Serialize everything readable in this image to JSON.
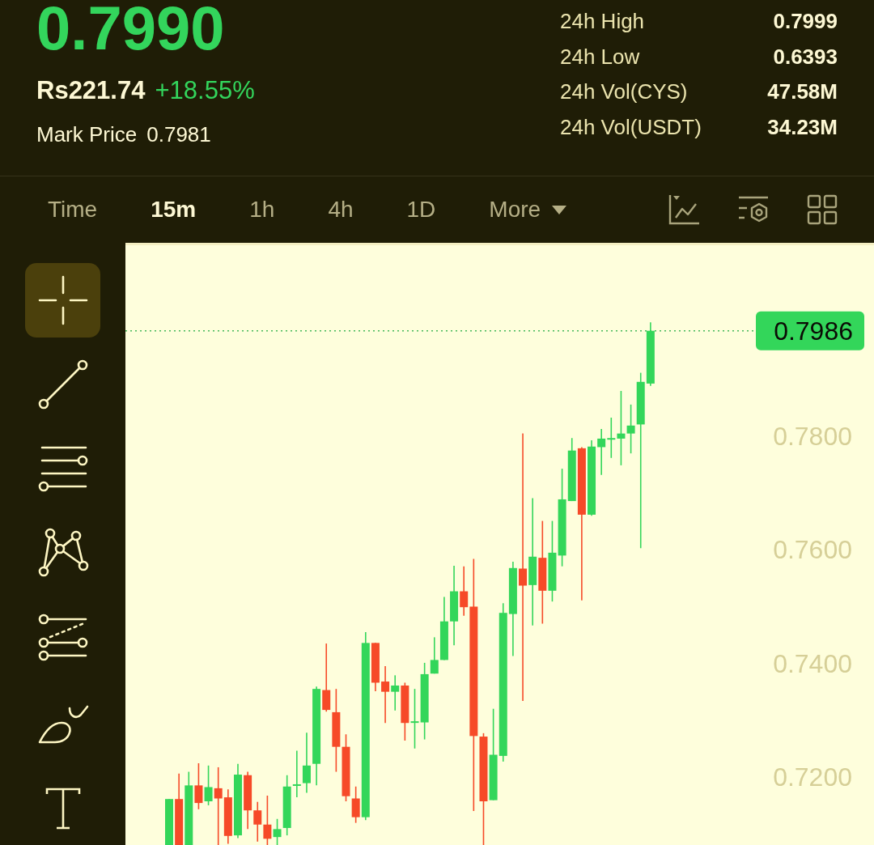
{
  "ticker": {
    "last_price": "0.7990",
    "fiat_price": "Rs221.74",
    "change": "+18.55%",
    "mark_price_label": "Mark Price",
    "mark_price": "0.7981"
  },
  "stats": [
    {
      "label": "24h High",
      "value": "0.7999"
    },
    {
      "label": "24h Low",
      "value": "0.6393"
    },
    {
      "label": "24h Vol(CYS)",
      "value": "47.58M"
    },
    {
      "label": "24h Vol(USDT)",
      "value": "34.23M"
    }
  ],
  "interval_tabs": [
    {
      "label": "Time",
      "kind": "tab",
      "selected": false
    },
    {
      "label": "15m",
      "kind": "tab",
      "selected": true
    },
    {
      "label": "1h",
      "kind": "tab",
      "selected": false
    },
    {
      "label": "4h",
      "kind": "tab",
      "selected": false
    },
    {
      "label": "1D",
      "kind": "tab",
      "selected": false
    },
    {
      "label": "More",
      "kind": "dropdown",
      "selected": false
    }
  ],
  "drawing_tools": [
    {
      "selected": true
    },
    {
      "selected": false
    },
    {
      "selected": false
    },
    {
      "selected": false
    },
    {
      "selected": false
    },
    {
      "selected": false
    },
    {
      "selected": false
    }
  ],
  "chart": {
    "price_axis_labels": [
      "0.7800",
      "0.7600",
      "0.7400",
      "0.7200"
    ],
    "last_price_tag": "0.7986"
  }
}
